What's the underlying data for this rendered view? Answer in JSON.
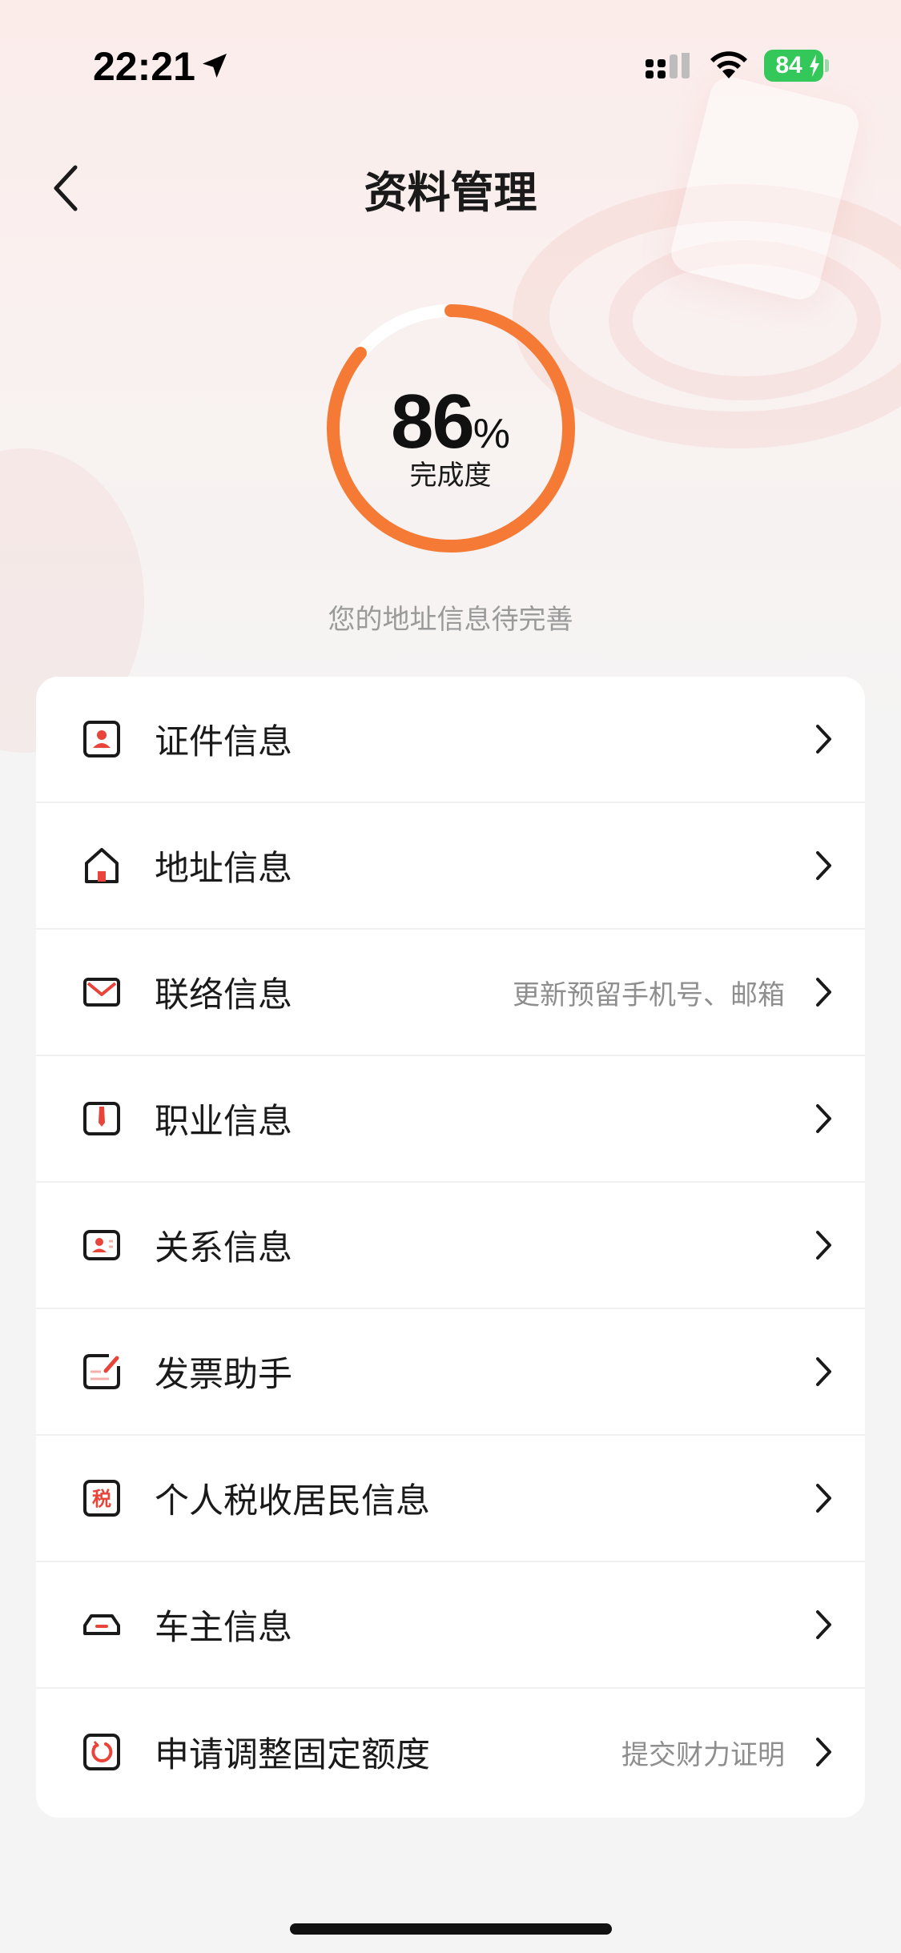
{
  "status_bar": {
    "time": "22:21",
    "battery_level": "84",
    "icons": [
      "location-arrow-icon",
      "cellular-signal-icon",
      "wifi-icon",
      "battery-charging-icon"
    ]
  },
  "header": {
    "back_icon": "chevron-left-icon",
    "title": "资料管理"
  },
  "progress": {
    "value": "86",
    "unit": "%",
    "percent": 86,
    "label": "完成度",
    "color": "#f47a35",
    "hint": "您的地址信息待完善"
  },
  "menu": {
    "items": [
      {
        "label": "证件信息",
        "sub": "",
        "icon": "id-card-icon"
      },
      {
        "label": "地址信息",
        "sub": "",
        "icon": "home-icon"
      },
      {
        "label": "联络信息",
        "sub": "更新预留手机号、邮箱",
        "icon": "mail-icon"
      },
      {
        "label": "职业信息",
        "sub": "",
        "icon": "briefcase-tie-icon"
      },
      {
        "label": "关系信息",
        "sub": "",
        "icon": "contact-card-icon"
      },
      {
        "label": "发票助手",
        "sub": "",
        "icon": "invoice-edit-icon"
      },
      {
        "label": "个人税收居民信息",
        "sub": "",
        "icon": "tax-icon"
      },
      {
        "label": "车主信息",
        "sub": "",
        "icon": "car-icon"
      },
      {
        "label": "申请调整固定额度",
        "sub": "提交财力证明",
        "icon": "limit-adjust-icon"
      }
    ],
    "tax_glyph": "税",
    "accent": "#e8443a"
  }
}
